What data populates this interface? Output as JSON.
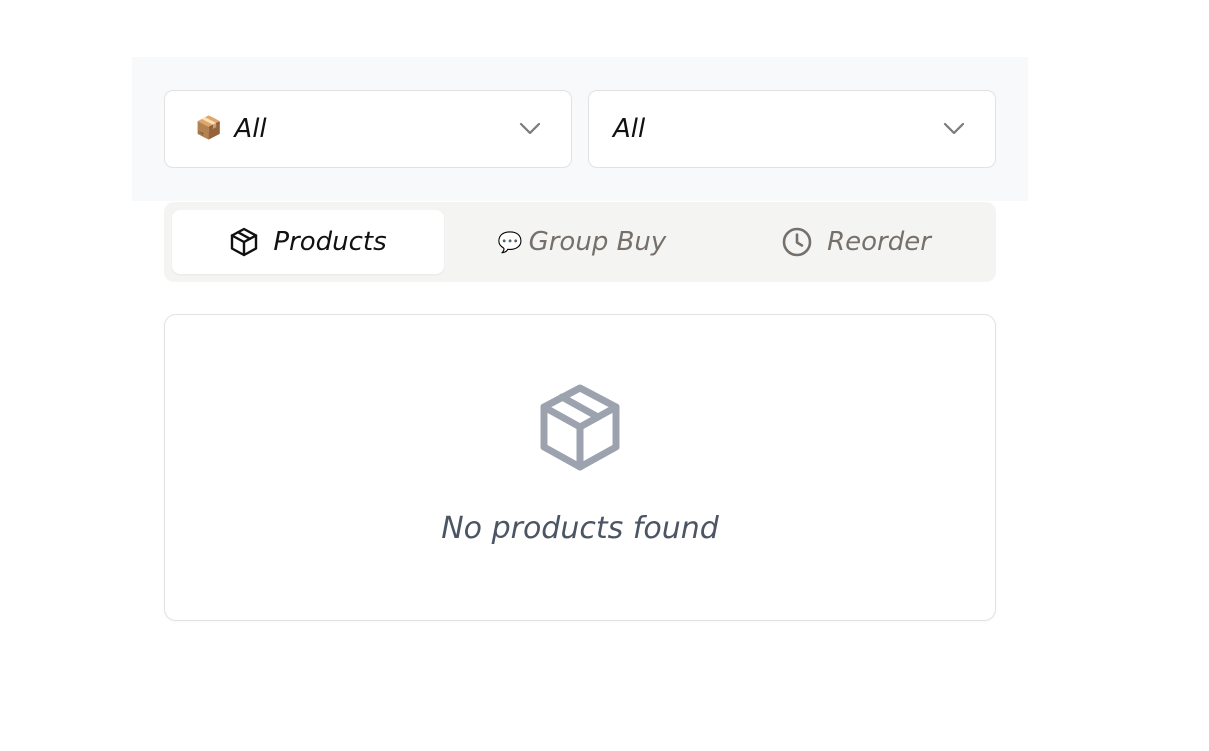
{
  "filters": {
    "category": {
      "icon": "package-emoji",
      "emoji": "📦",
      "value": "All"
    },
    "secondary": {
      "value": "All"
    }
  },
  "tabs": [
    {
      "label": "Products",
      "icon": "package-icon",
      "active": true
    },
    {
      "label": "Group Buy",
      "icon": "speech-bubble-emoji",
      "emoji": "💬",
      "active": false
    },
    {
      "label": "Reorder",
      "icon": "clock-icon",
      "active": false
    }
  ],
  "empty_state": {
    "icon": "package-icon",
    "message": "No products found"
  },
  "colors": {
    "icon_gray": "#9ca3af",
    "muted_text": "#76706a",
    "empty_text": "#4b5563"
  }
}
